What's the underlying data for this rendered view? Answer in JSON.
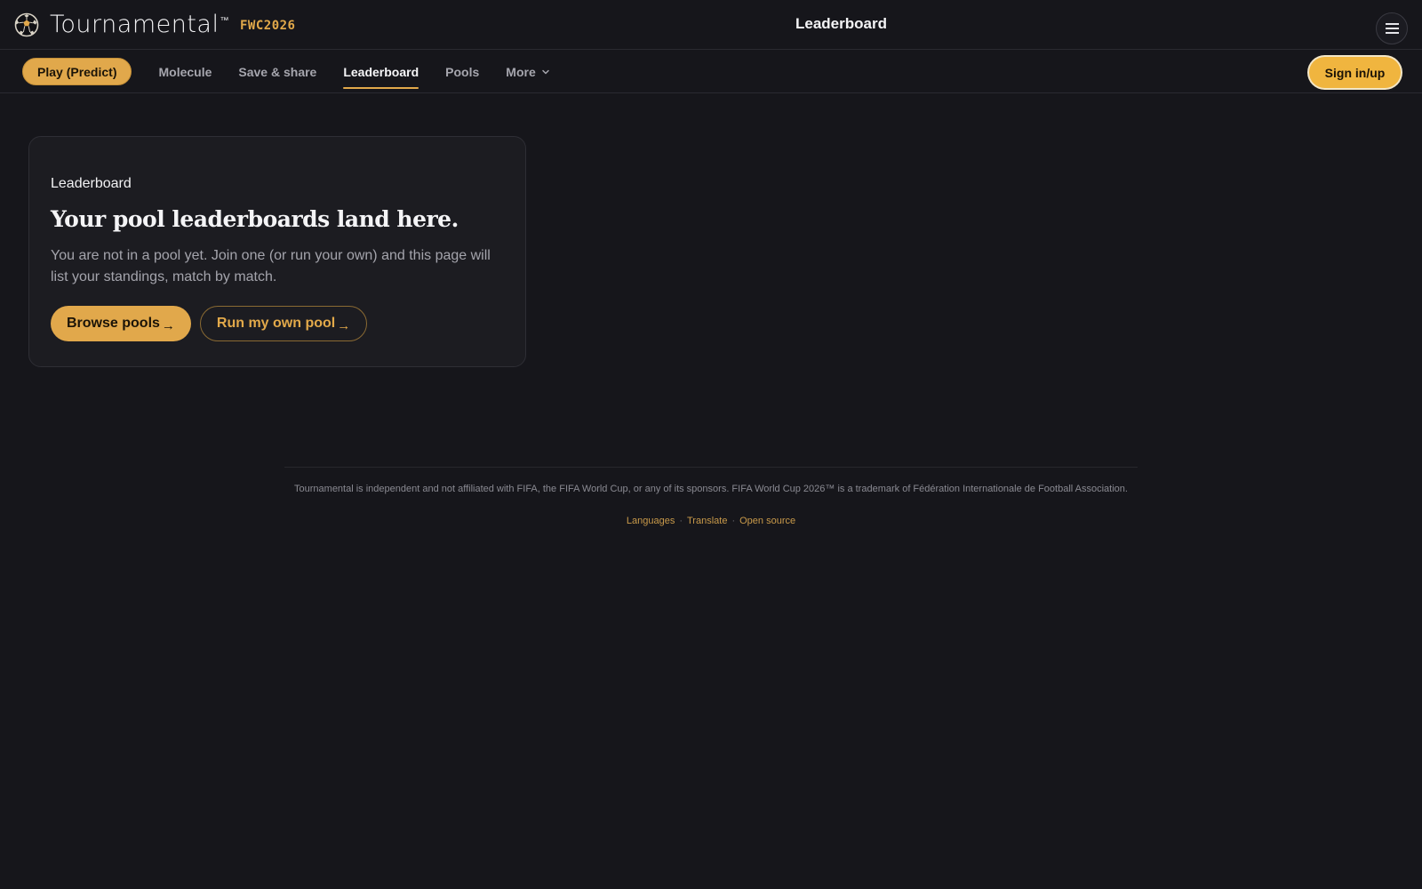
{
  "brand": {
    "name": "Tournamental",
    "trademark": "™",
    "tag": "FWC2026",
    "icon": "soccer-ball-icon"
  },
  "header": {
    "title": "Leaderboard",
    "menu_icon": "hamburger-menu-icon"
  },
  "nav": {
    "play_label": "Play (Predict)",
    "items": [
      {
        "label": "Molecule"
      },
      {
        "label": "Save & share"
      },
      {
        "label": "Leaderboard",
        "active": true
      },
      {
        "label": "Pools"
      },
      {
        "label": "More"
      }
    ],
    "more_icon": "chevron-down-icon",
    "signin_label": "Sign in/up"
  },
  "card": {
    "eyebrow": "Leaderboard",
    "title": "Your pool leaderboards land here.",
    "body": "You are not in a pool yet. Join one (or run your own) and this page will list your standings, match by match.",
    "primary_label": "Browse pools",
    "secondary_label": "Run my own pool",
    "arrow": "→"
  },
  "footer": {
    "disclaimer": "Tournamental is independent and not affiliated with FIFA, the FIFA World Cup, or any of its sponsors. FIFA World Cup 2026™ is a trademark of Fédération Internationale de Football Association.",
    "links": [
      "Languages",
      "Translate",
      "Open source"
    ],
    "separator": "·"
  },
  "colors": {
    "background": "#16161b",
    "accent": "#e1a84b",
    "signin": "#f0b53f",
    "card": "#1c1c21"
  }
}
